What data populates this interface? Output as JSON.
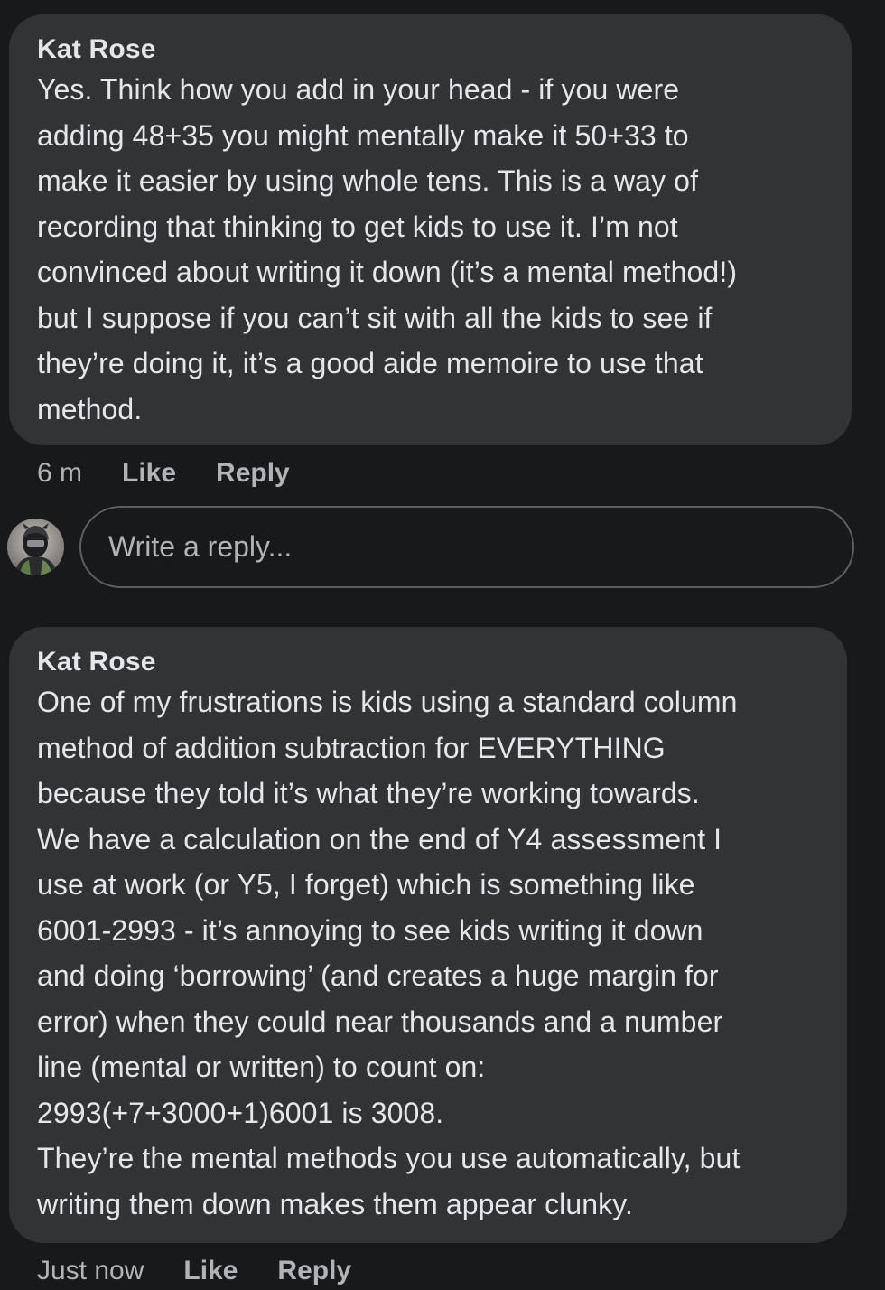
{
  "comments": [
    {
      "author": "Kat Rose",
      "text": "Yes. Think how you add in your head - if you were\nadding 48+35 you might mentally make it 50+33 to\nmake it easier by using whole tens. This is a way of\nrecording that thinking to get kids to use it. I’m not\nconvinced about writing it down (it’s a mental method!)\nbut I suppose if you can’t sit with all the kids to see if\nthey’re doing it, it’s a good aide memoire to use that\nmethod.",
      "time": "6 m",
      "like_label": "Like",
      "reply_label": "Reply"
    },
    {
      "author": "Kat Rose",
      "text": "One of my frustrations is kids using a standard column\nmethod of addition subtraction for EVERYTHING\nbecause they told it’s what they’re working towards.\nWe have a calculation on the end of Y4 assessment I\nuse at work (or Y5, I forget) which is something like\n6001-2993 - it’s annoying to see kids writing it down\nand doing ‘borrowing’ (and creates a huge margin for\nerror) when they could near thousands and a number\nline (mental or written) to count on:\n2993(+7+3000+1)6001 is 3008.\nThey’re the mental methods you use automatically, but\nwriting them down makes them appear clunky.",
      "time": "Just now",
      "like_label": "Like",
      "reply_label": "Reply"
    }
  ],
  "reply_box": {
    "placeholder": "Write a reply..."
  },
  "colors": {
    "background": "#18191a",
    "bubble": "#323335",
    "primary_text": "#e4e6eb",
    "secondary_text": "#b0b3b8",
    "input_border": "#5c5e62"
  },
  "icons": {
    "avatar": "user-avatar"
  }
}
